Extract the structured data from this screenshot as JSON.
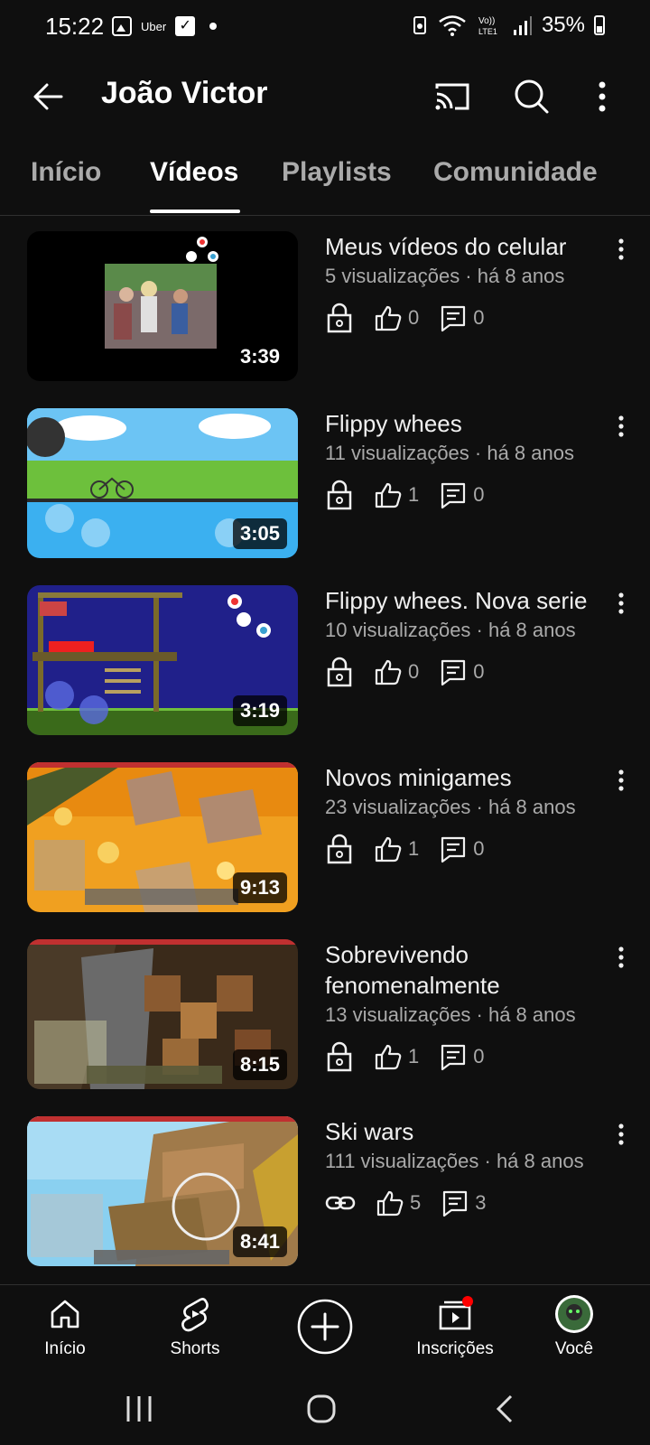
{
  "status_bar": {
    "time": "15:22",
    "notification_text": "Uber",
    "battery": "35%"
  },
  "header": {
    "title": "João Victor"
  },
  "tabs": [
    {
      "label": "Início",
      "active": false
    },
    {
      "label": "Vídeos",
      "active": true
    },
    {
      "label": "Playlists",
      "active": false
    },
    {
      "label": "Comunidade",
      "active": false
    }
  ],
  "videos": [
    {
      "title": "Meus vídeos do celular",
      "meta": "5 visualizações · há 8 anos",
      "duration": "3:39",
      "privacy_icon": "lock-icon",
      "likes": "0",
      "comments": "0"
    },
    {
      "title": "Flippy whees",
      "meta": "11 visualizações · há 8 anos",
      "duration": "3:05",
      "privacy_icon": "lock-icon",
      "likes": "1",
      "comments": "0"
    },
    {
      "title": "Flippy whees. Nova serie",
      "meta": "10 visualizações · há 8 anos",
      "duration": "3:19",
      "privacy_icon": "lock-icon",
      "likes": "0",
      "comments": "0"
    },
    {
      "title": "Novos minigames",
      "meta": "23 visualizações · há 8 anos",
      "duration": "9:13",
      "privacy_icon": "lock-icon",
      "likes": "1",
      "comments": "0"
    },
    {
      "title": "Sobrevivendo fenomenalmente",
      "meta": "13 visualizações · há 8 anos",
      "duration": "8:15",
      "privacy_icon": "lock-icon",
      "likes": "1",
      "comments": "0"
    },
    {
      "title": "Ski wars",
      "meta": "111 visualizações · há 8 anos",
      "duration": "8:41",
      "privacy_icon": "link-icon",
      "likes": "5",
      "comments": "3"
    }
  ],
  "bottom_nav": [
    {
      "label": "Início",
      "icon": "home-icon"
    },
    {
      "label": "Shorts",
      "icon": "shorts-icon"
    },
    {
      "label": "",
      "icon": "create-icon"
    },
    {
      "label": "Inscrições",
      "icon": "subscriptions-icon"
    },
    {
      "label": "Você",
      "icon": "avatar"
    }
  ],
  "colors": {
    "background": "#0f0f0f",
    "text_primary": "#f1f1f1",
    "text_secondary": "#aaaaaa",
    "notification_dot": "#ff0000"
  }
}
